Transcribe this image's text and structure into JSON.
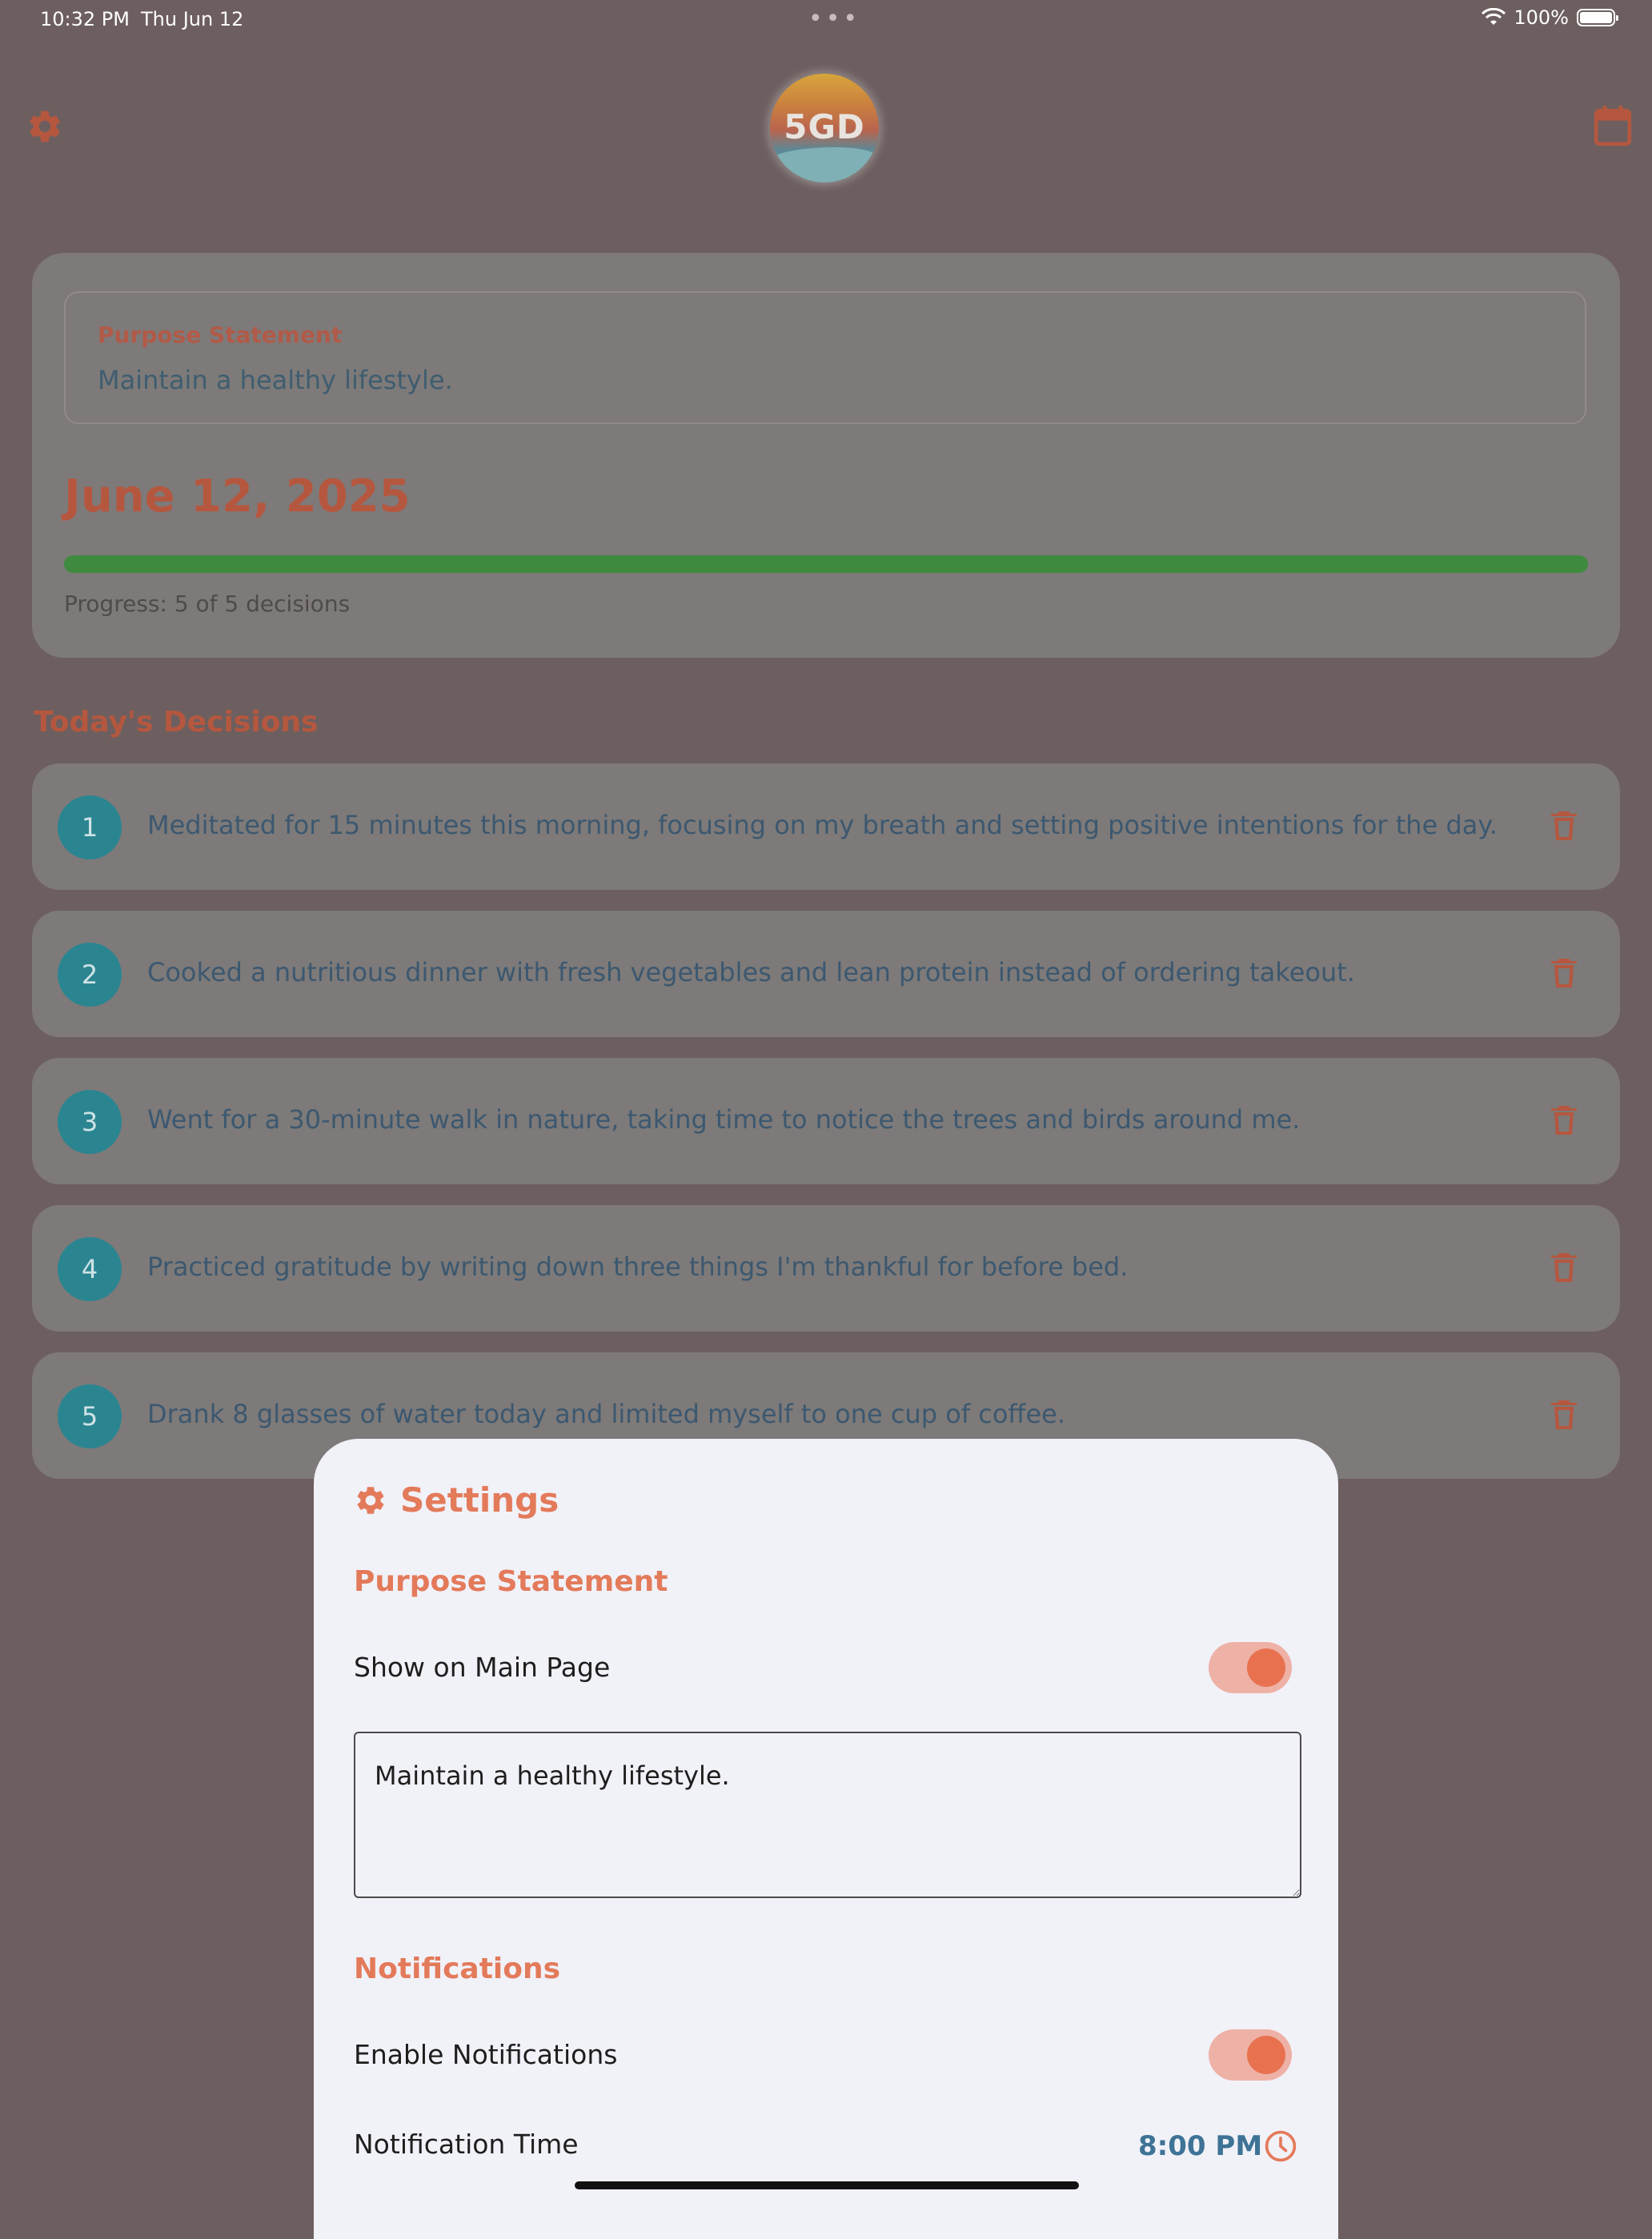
{
  "status_bar": {
    "time": "10:32 PM",
    "date": "Thu Jun 12",
    "battery": "100%"
  },
  "header": {
    "logo_text": "5GD",
    "settings_icon": "gear-icon",
    "calendar_icon": "calendar-icon"
  },
  "summary": {
    "purpose_label": "Purpose Statement",
    "purpose_text": "Maintain a healthy lifestyle.",
    "date": "June 12, 2025",
    "progress_fraction": 1.0,
    "progress_text": "Progress: 5 of 5 decisions"
  },
  "decisions_title": "Today's Decisions",
  "decisions": [
    {
      "number": "1",
      "text": "Meditated for 15 minutes this morning, focusing on my breath and setting positive intentions for the day."
    },
    {
      "number": "2",
      "text": "Cooked a nutritious dinner with fresh vegetables and lean protein instead of ordering takeout."
    },
    {
      "number": "3",
      "text": "Went for a 30-minute walk in nature, taking time to notice the trees and birds around me."
    },
    {
      "number": "4",
      "text": "Practiced gratitude by writing down three things I'm thankful for before bed."
    },
    {
      "number": "5",
      "text": "Drank 8 glasses of water today and limited myself to one cup of coffee."
    }
  ],
  "settings": {
    "title": "Settings",
    "purpose_section": "Purpose Statement",
    "show_on_main_label": "Show on Main Page",
    "show_on_main_enabled": true,
    "purpose_value": "Maintain a healthy lifestyle.",
    "notifications_section": "Notifications",
    "enable_notifications_label": "Enable Notifications",
    "notifications_enabled": true,
    "notification_time_label": "Notification Time",
    "notification_time": "8:00 PM"
  },
  "colors": {
    "accent": "#e37a5a",
    "teal": "#2b8591",
    "progress": "#3f8a3f",
    "blue_text": "#3e7396"
  }
}
